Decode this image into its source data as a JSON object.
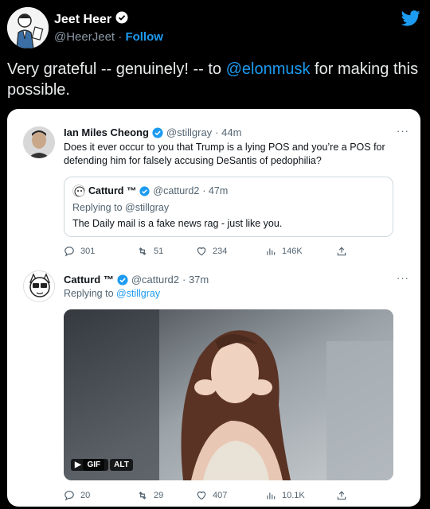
{
  "header": {
    "name": "Jeet Heer",
    "handle": "@HeerJeet",
    "separator": "·",
    "follow_label": "Follow"
  },
  "tweet": {
    "text_before": "Very grateful -- genuinely! -- to ",
    "mention": "@elonmusk",
    "text_after": " for making this possible."
  },
  "embedded": {
    "tweet1": {
      "name": "Ian Miles Cheong",
      "handle": "@stillgray",
      "time": "· 44m",
      "body": "Does it ever occur to you that Trump is a lying POS and you’re a POS for defending him for falsely accusing DeSantis of pedophilia?",
      "more": "···",
      "quote": {
        "name": "Catturd ™",
        "handle": "@catturd2",
        "time": "· 47m",
        "reply_prefix": "Replying to ",
        "reply_handle": "@stillgray",
        "body": "The Daily mail is a fake news rag - just like you."
      },
      "actions": {
        "replies": "301",
        "retweets": "51",
        "likes": "234",
        "views": "146K"
      }
    },
    "tweet2": {
      "name": "Catturd ™",
      "handle": "@catturd2",
      "time": "· 37m",
      "more": "···",
      "reply_prefix": "Replying to ",
      "reply_handle": "@stillgray",
      "media": {
        "gif_label": "GIF",
        "alt_label": "ALT"
      },
      "actions": {
        "replies": "20",
        "retweets": "29",
        "likes": "407",
        "views": "10.1K"
      }
    }
  },
  "colors": {
    "background": "#000000",
    "accent": "#1d9bf0",
    "muted": "#8b98a5",
    "card": "#ffffff"
  }
}
